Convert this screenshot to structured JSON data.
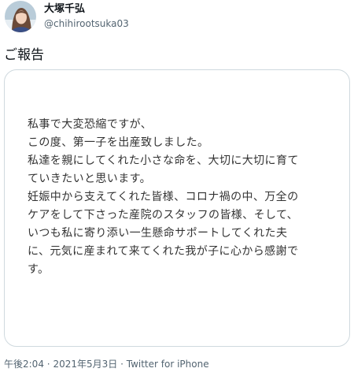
{
  "author": {
    "display_name": "大塚千弘",
    "handle": "@chihirootsuka03"
  },
  "tweet": {
    "text": "ご報告",
    "image_text": "私事で大変恐縮ですが、\nこの度、第一子を出産致しました。\n私達を親にしてくれた小さな命を、大切に大切に育て\nていきたいと思います。\n妊娠中から支えてくれた皆様、コロナ禍の中、万全の\nケアをして下さった産院のスタッフの皆様、そして、\nいつも私に寄り添い一生懸命サポートしてくれた夫\nに、元気に産まれて来てくれた我が子に心から感謝で\nす。"
  },
  "meta": {
    "time": "午後2:04",
    "date": "2021年5月3日",
    "separator": "·",
    "source": "Twitter for iPhone"
  }
}
